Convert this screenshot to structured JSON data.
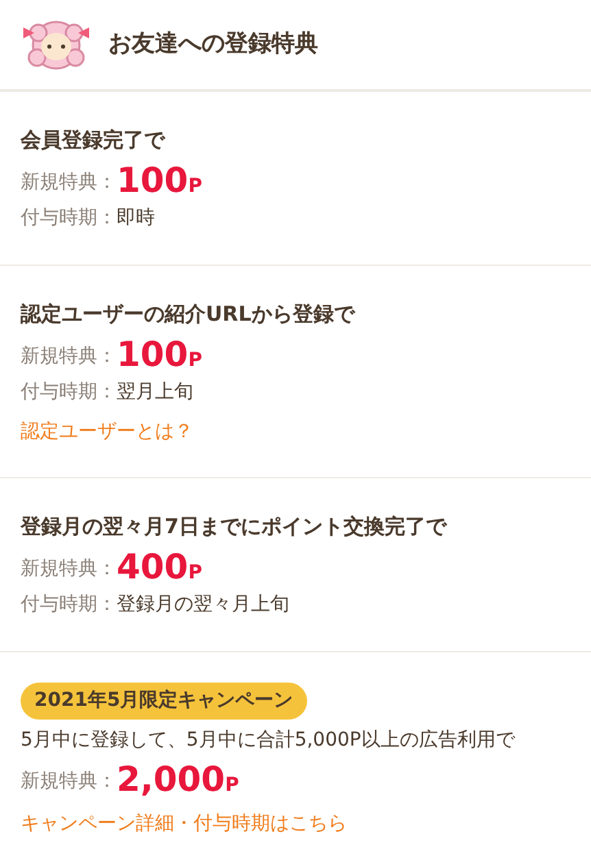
{
  "header": {
    "title": "お友達への登録特典"
  },
  "sections": [
    {
      "title": "会員登録完了で",
      "benefit_label": "新規特典：",
      "benefit_value": "100",
      "benefit_unit": "P",
      "timing_label": "付与時期：",
      "timing_value": "即時"
    },
    {
      "title": "認定ユーザーの紹介URLから登録で",
      "benefit_label": "新規特典：",
      "benefit_value": "100",
      "benefit_unit": "P",
      "timing_label": "付与時期：",
      "timing_value": "翌月上旬",
      "link": "認定ユーザーとは？"
    },
    {
      "title": "登録月の翌々月7日までにポイント交換完了で",
      "benefit_label": "新規特典：",
      "benefit_value": "400",
      "benefit_unit": "P",
      "timing_label": "付与時期：",
      "timing_value": "登録月の翌々月上旬"
    },
    {
      "badge": "2021年5月限定キャンペーン",
      "description": "5月中に登録して、5月中に合計5,000P以上の広告利用で",
      "benefit_label": "新規特典：",
      "benefit_value": "2,000",
      "benefit_unit": "P",
      "link": "キャンペーン詳細・付与時期はこちら"
    }
  ]
}
